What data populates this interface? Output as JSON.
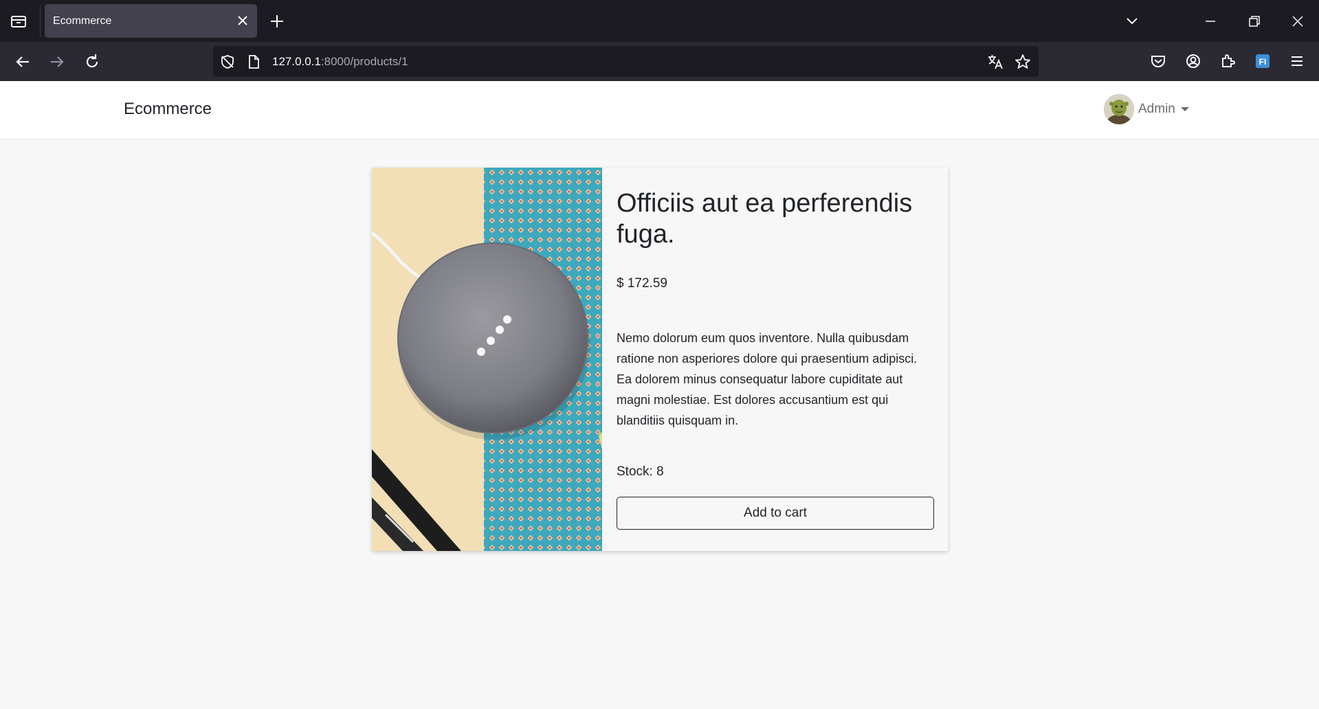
{
  "browser": {
    "tab_title": "Ecommerce",
    "url_host": "127.0.0.1",
    "url_rest": ":8000/products/1"
  },
  "header": {
    "brand": "Ecommerce",
    "user_name": "Admin"
  },
  "product": {
    "title": "Officiis aut ea perferendis fuga.",
    "price": "$ 172.59",
    "description": "Nemo dolorum eum quos inventore. Nulla quibusdam ratione non asperiores dolore qui praesentium adipisci. Ea dolorem minus consequatur labore cupiditate aut magni molestiae. Est dolores accusantium est qui blanditiis quisquam in.",
    "stock": "Stock: 8",
    "add_to_cart_label": "Add to cart"
  }
}
